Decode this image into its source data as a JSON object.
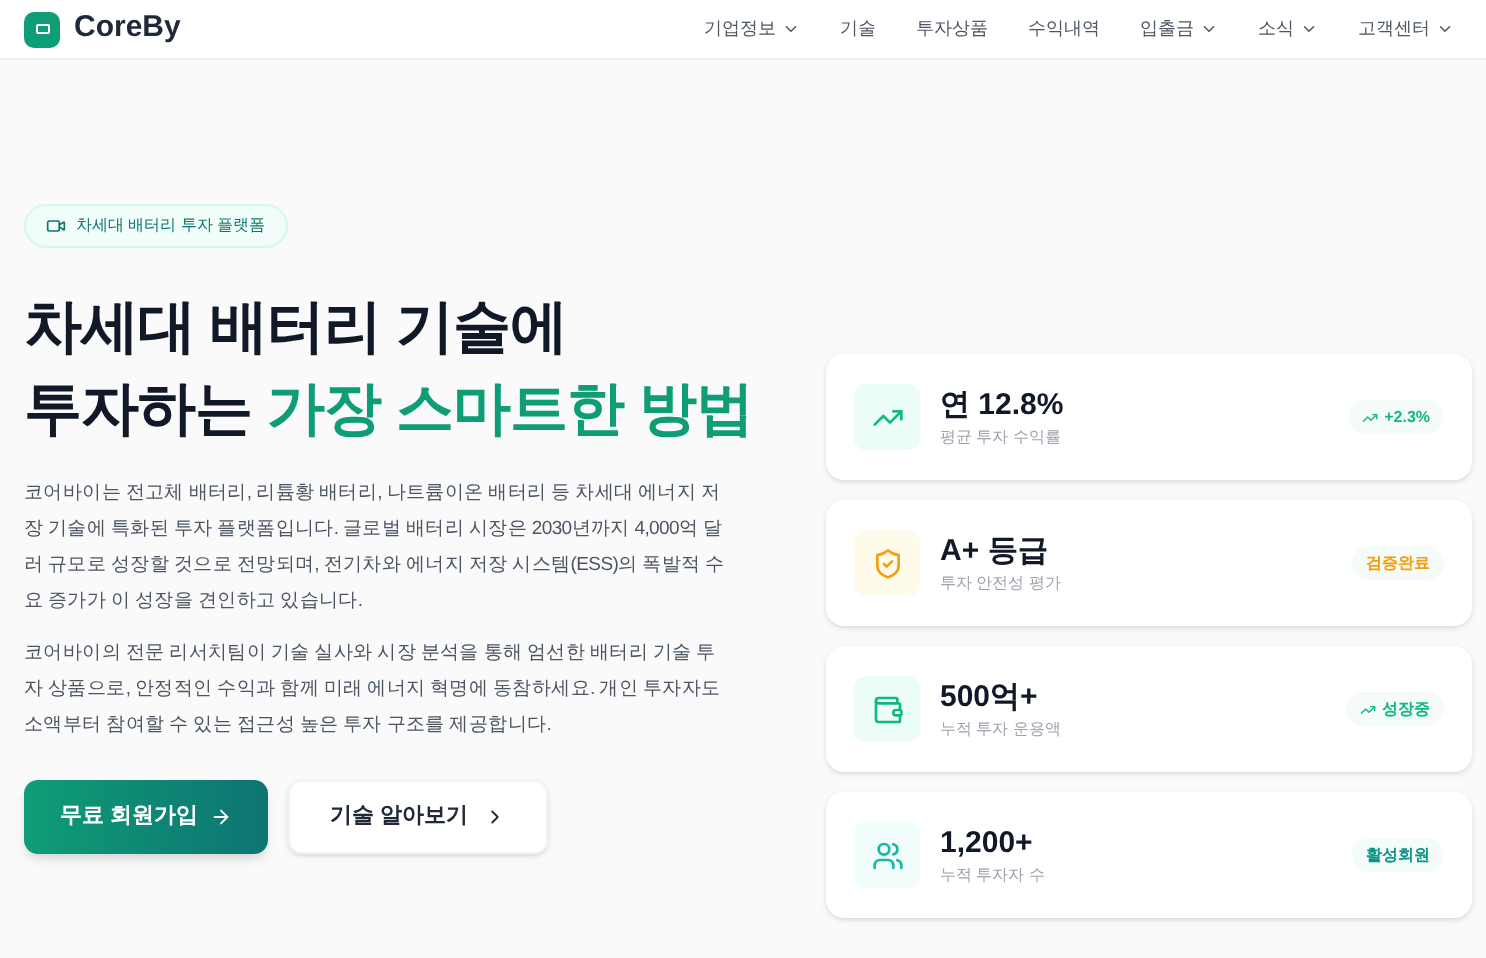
{
  "brand": {
    "name": "CoreBy"
  },
  "nav": [
    {
      "label": "기업정보",
      "dropdown": true
    },
    {
      "label": "기술",
      "dropdown": false
    },
    {
      "label": "투자상품",
      "dropdown": false
    },
    {
      "label": "수익내역",
      "dropdown": false
    },
    {
      "label": "입출금",
      "dropdown": true
    },
    {
      "label": "소식",
      "dropdown": true
    },
    {
      "label": "고객센터",
      "dropdown": true
    }
  ],
  "hero": {
    "tag": "차세대 배터리 투자 플랫폼",
    "title_line1": "차세대 배터리 기술에",
    "title_plain": "투자하는 ",
    "title_highlight": "가장 스마트한 방법",
    "paragraphs": [
      "코어바이는 전고체 배터리, 리튬황 배터리, 나트륨이온 배터리 등 차세대 에너지 저장 기술에 특화된 투자 플랫폼입니다. 글로벌 배터리 시장은 2030년까지 4,000억 달러 규모로 성장할 것으로 전망되며, 전기차와 에너지 저장 시스템(ESS)의 폭발적 수요 증가가 이 성장을 견인하고 있습니다.",
      "코어바이의 전문 리서치팀이 기술 실사와 시장 분석을 통해 엄선한 배터리 기술 투자 상품으로, 안정적인 수익과 함께 미래 에너지 혁명에 동참하세요. 개인 투자자도 소액부터 참여할 수 있는 접근성 높은 투자 구조를 제공합니다."
    ],
    "primary_button": "무료 회원가입",
    "secondary_button": "기술 알아보기"
  },
  "stats": [
    {
      "kind": "trend",
      "value": "연 12.8%",
      "label": "평균 투자 수익률",
      "badge": {
        "text": "+2.3%",
        "trend_icon": true,
        "color": "#10b981"
      }
    },
    {
      "kind": "shield",
      "value": "A+ 등급",
      "label": "투자 안전성 평가",
      "badge": {
        "text": "검증완료",
        "trend_icon": false,
        "color": "#f59e0b"
      }
    },
    {
      "kind": "wallet",
      "value": "500억+",
      "label": "누적 투자 운용액",
      "badge": {
        "text": "성장중",
        "trend_icon": true,
        "color": "#10b981"
      }
    },
    {
      "kind": "users",
      "value": "1,200+",
      "label": "누적 투자자 수",
      "badge": {
        "text": "활성회원",
        "trend_icon": false,
        "color": "#0d9488"
      }
    }
  ]
}
